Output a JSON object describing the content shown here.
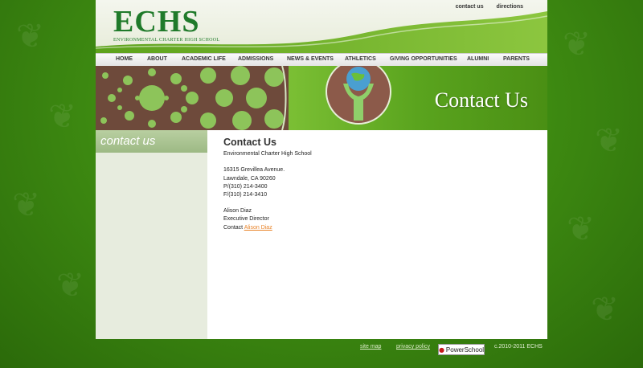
{
  "header": {
    "logo_letters": "ECHS",
    "logo_tagline": "ENVIRONMENTAL CHARTER HIGH SCHOOL",
    "top_links": [
      "contact us",
      "directions"
    ]
  },
  "nav": {
    "items": [
      "HOME",
      "ABOUT",
      "ACADEMIC LIFE",
      "ADMISSIONS",
      "NEWS & EVENTS",
      "ATHLETICS",
      "GIVING OPPORTUNITIES",
      "ALUMNI",
      "PARENTS"
    ]
  },
  "banner": {
    "title": "Contact Us"
  },
  "sidebar": {
    "heading": "contact us"
  },
  "content": {
    "heading": "Contact Us",
    "school_name": "Environmental Charter High School",
    "address_line1": "16315 Grevillea Avenue.",
    "address_line2": "Lawndale, CA 90260",
    "phone": "P/(310) 214-3400",
    "fax": "F/(310) 214-3410",
    "contact_name": "Alison Diaz",
    "contact_title": "Executive Director",
    "contact_prefix": "Contact ",
    "contact_link": "Alison Diaz"
  },
  "footer": {
    "site_map": "site map",
    "privacy_policy": "privacy policy",
    "powerschool": "PowerSchool",
    "copyright": "c.2010-2011 ECHS"
  },
  "colors": {
    "brand_green": "#1f7a2a",
    "link_orange": "#e8842a",
    "background_green": "#3f8d12"
  }
}
